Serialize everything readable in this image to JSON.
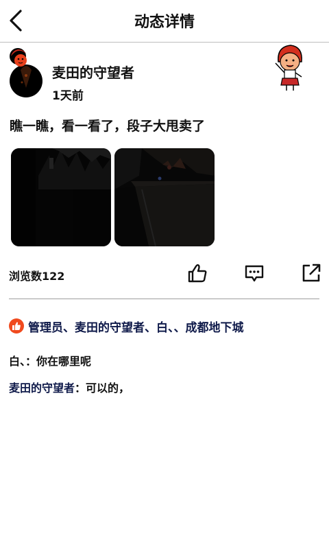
{
  "header": {
    "title": "动态详情"
  },
  "post": {
    "username": "麦田的守望者",
    "time": "1天前",
    "text": "瞧一瞧，看一看了，段子大甩卖了",
    "views": "浏览数122"
  },
  "icons": {
    "back": "chevron-left-icon",
    "like": "thumbs-up-icon",
    "comment": "comment-dots-icon",
    "share": "external-share-icon"
  },
  "likes": {
    "text": "管理员、麦田的守望者、白、、成都地下城"
  },
  "comments": [
    {
      "author": "白、",
      "separator": "：",
      "content": "你在哪里呢"
    },
    {
      "author": "麦田的守望者",
      "separator": "：",
      "content": "可以的，"
    }
  ],
  "colors": {
    "like_badge": "#f04a1e",
    "names": "#0f1a4a"
  }
}
